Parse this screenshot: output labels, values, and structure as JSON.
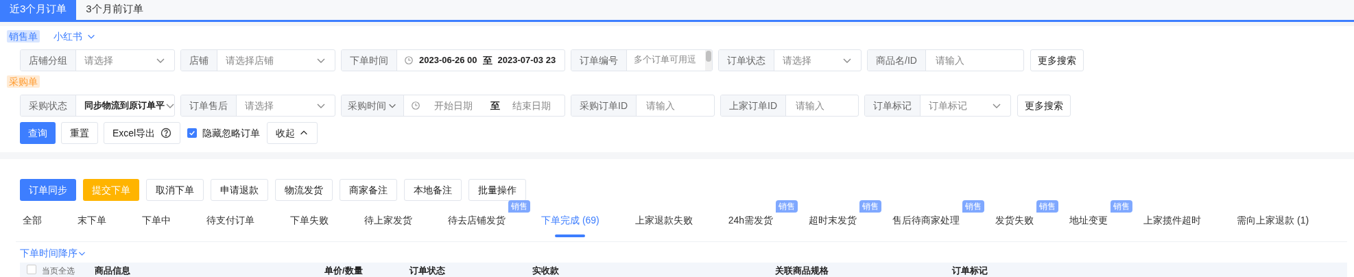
{
  "top_tabs": [
    {
      "label": "近3个月订单",
      "selected": true
    },
    {
      "label": "3个月前订单",
      "selected": false
    }
  ],
  "sections": [
    {
      "badge": "销售单",
      "color": "#3d7eff",
      "platform": "小红书",
      "fields": [
        {
          "kind": "select",
          "label": "店铺分组",
          "placeholder": "请选择"
        },
        {
          "kind": "select",
          "label": "店铺",
          "placeholder": "请选择店铺"
        },
        {
          "kind": "daterange",
          "label": "下单时间",
          "start": "2023-06-26 00",
          "separator": "至",
          "end": "2023-07-03 23"
        },
        {
          "kind": "textarea",
          "label": "订单编号",
          "placeholder": "多个订单可用逗"
        },
        {
          "kind": "select",
          "label": "订单状态",
          "placeholder": "请选择"
        },
        {
          "kind": "input",
          "label": "商品名/ID",
          "placeholder": "请输入"
        }
      ],
      "more": "更多搜索"
    },
    {
      "badge": "采购单",
      "color": "#ff9a2e",
      "fields": [
        {
          "kind": "select",
          "label": "采购状态",
          "value": "同步物流到原订单平"
        },
        {
          "kind": "select",
          "label": "订单售后",
          "placeholder": "请选择"
        },
        {
          "kind": "daterange",
          "label": "采购时间",
          "label_dropdown": true,
          "start_placeholder": "开始日期",
          "separator": "至",
          "end_placeholder": "结束日期"
        },
        {
          "kind": "input",
          "label": "采购订单ID",
          "placeholder": "请输入"
        },
        {
          "kind": "input",
          "label": "上家订单ID",
          "placeholder": "请输入"
        },
        {
          "kind": "select",
          "label": "订单标记",
          "placeholder": "订单标记"
        }
      ],
      "more": "更多搜索"
    }
  ],
  "query_bar": {
    "query": "查询",
    "reset": "重置",
    "export": "Excel导出",
    "hide_ignored": {
      "label": "隐藏忽略订单",
      "checked": true
    },
    "collapse": "收起"
  },
  "actions": [
    {
      "label": "订单同步",
      "kind": "primary"
    },
    {
      "label": "提交下单",
      "kind": "warning"
    },
    {
      "label": "取消下单",
      "kind": "default"
    },
    {
      "label": "申请退款",
      "kind": "default"
    },
    {
      "label": "物流发货",
      "kind": "default"
    },
    {
      "label": "商家备注",
      "kind": "default"
    },
    {
      "label": "本地备注",
      "kind": "default"
    },
    {
      "label": "批量操作",
      "kind": "default"
    }
  ],
  "status_tabs": [
    {
      "label": "全部",
      "selected": false
    },
    {
      "label": "末下单",
      "selected": false
    },
    {
      "label": "下单中",
      "selected": false
    },
    {
      "label": "待支付订单",
      "selected": false
    },
    {
      "label": "下单失败",
      "selected": false
    },
    {
      "label": "待上家发货",
      "selected": false
    },
    {
      "label": "待去店铺发货",
      "selected": false,
      "badge": "销售"
    },
    {
      "label": "下单完成 (69)",
      "selected": true
    },
    {
      "label": "上家退款失败",
      "selected": false
    },
    {
      "label": "24h需发货",
      "selected": false,
      "badge": "销售"
    },
    {
      "label": "超时末发货",
      "selected": false,
      "badge": "销售"
    },
    {
      "label": "售后待商家处理",
      "selected": false,
      "badge": "销售"
    },
    {
      "label": "发货失败",
      "selected": false,
      "badge": "销售"
    },
    {
      "label": "地址变更",
      "selected": false,
      "badge": "销售"
    },
    {
      "label": "上家揽件超时",
      "selected": false
    },
    {
      "label": "需向上家退款 (1)",
      "selected": false
    }
  ],
  "sort": "下单时间降序",
  "table": {
    "select_all": "当页全选",
    "select_all_checked": false,
    "columns": [
      "商品信息",
      "单价/数量",
      "订单状态",
      "实收款",
      "关联商品规格",
      "订单标记"
    ]
  }
}
